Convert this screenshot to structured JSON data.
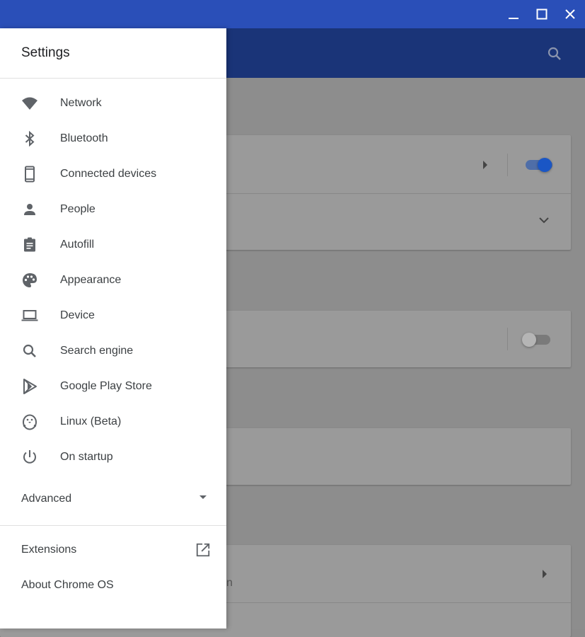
{
  "window": {
    "controls": [
      "minimize-icon",
      "maximize-icon",
      "close-icon"
    ]
  },
  "colors": {
    "titlebar": "#2a4fb8",
    "toolbar": "#1a3478",
    "accent": "#1a56c5",
    "icon": "#5f6368",
    "text": "#3c4043"
  },
  "drawer": {
    "title": "Settings",
    "items": [
      {
        "label": "Network",
        "icon": "wifi-icon"
      },
      {
        "label": "Bluetooth",
        "icon": "bluetooth-icon"
      },
      {
        "label": "Connected devices",
        "icon": "phone-icon"
      },
      {
        "label": "People",
        "icon": "person-icon"
      },
      {
        "label": "Autofill",
        "icon": "clipboard-icon"
      },
      {
        "label": "Appearance",
        "icon": "palette-icon"
      },
      {
        "label": "Device",
        "icon": "laptop-icon"
      },
      {
        "label": "Search engine",
        "icon": "search-icon"
      },
      {
        "label": "Google Play Store",
        "icon": "play-store-icon"
      },
      {
        "label": "Linux (Beta)",
        "icon": "penguin-icon"
      },
      {
        "label": "On startup",
        "icon": "power-icon"
      }
    ],
    "advanced_label": "Advanced",
    "extensions_label": "Extensions",
    "about_label": "About Chrome OS"
  },
  "background": {
    "partial_text": "n",
    "toggles": [
      {
        "state": "on"
      },
      {
        "state": "off"
      }
    ]
  }
}
